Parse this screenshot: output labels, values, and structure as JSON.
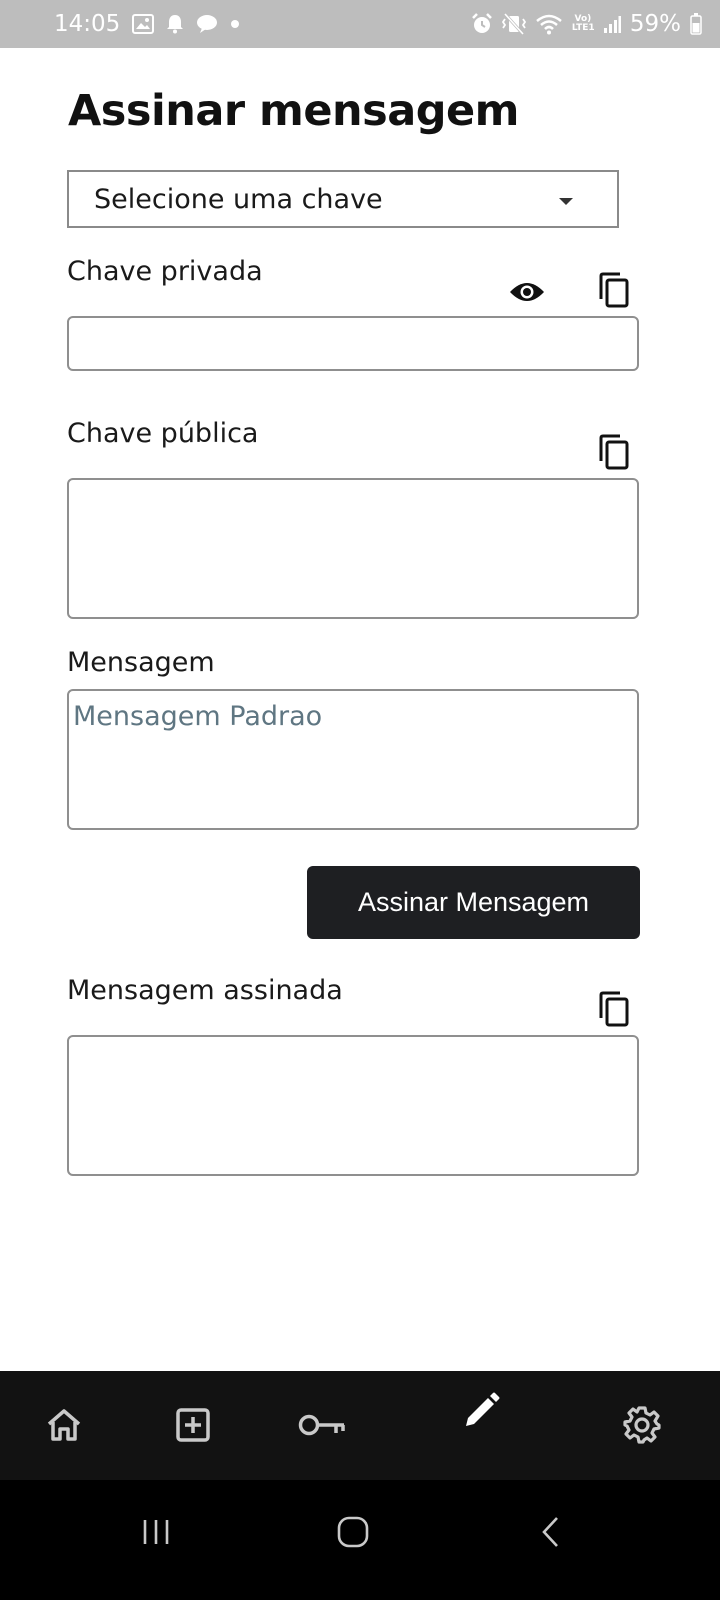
{
  "status_bar": {
    "time": "14:05",
    "battery_percent": "59%",
    "network_label": "Vo) LTE1",
    "left_icons": [
      "gallery-icon",
      "notification-bell-icon",
      "chat-bubble-icon",
      "dot-icon"
    ],
    "right_icons": [
      "alarm-icon",
      "vibrate-mute-icon",
      "wifi-icon",
      "signal-icon",
      "battery-icon"
    ]
  },
  "page": {
    "title": "Assinar mensagem"
  },
  "key_select": {
    "selected_value": "Selecione uma chave"
  },
  "private_key": {
    "label": "Chave privada",
    "value": ""
  },
  "public_key": {
    "label": "Chave pública",
    "value": ""
  },
  "message": {
    "label": "Mensagem",
    "placeholder": "Mensagem Padrao"
  },
  "sign_button": {
    "label": "Assinar Mensagem"
  },
  "signed_message": {
    "label": "Mensagem assinada",
    "value": ""
  },
  "bottom_nav": {
    "items": [
      "home-icon",
      "add-box-icon",
      "key-icon",
      "edit-pencil-icon",
      "settings-gear-icon"
    ],
    "active": "edit-pencil-icon"
  },
  "colors": {
    "status_bar_bg": "#bdbdbd",
    "button_bg": "#1e1f22",
    "nav_bg": "#121212",
    "placeholder": "#5f7682"
  }
}
